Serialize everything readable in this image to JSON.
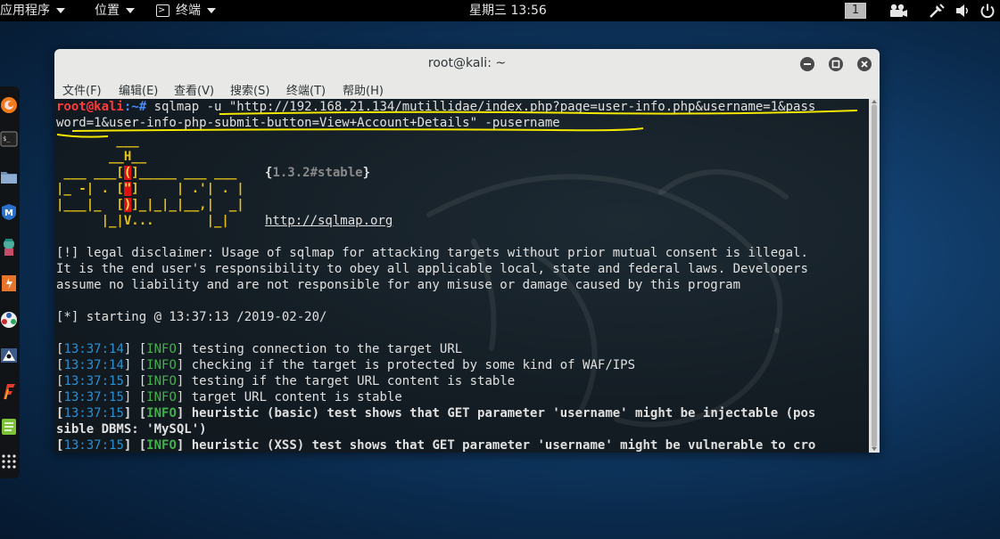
{
  "topbar": {
    "apps_label": "应用程序",
    "places_label": "位置",
    "terminal_label": "终端",
    "clock": "星期三 13:56",
    "workspace": "1"
  },
  "dock": {
    "items": [
      "firefox",
      "terminal",
      "files",
      "metasploit",
      "armitage",
      "burpsuite",
      "maltego",
      "beef",
      "faraday",
      "leafpad",
      "show-apps"
    ]
  },
  "window": {
    "title": "root@kali: ~",
    "menu": [
      "文件(F)",
      "编辑(E)",
      "查看(V)",
      "搜索(S)",
      "终端(T)",
      "帮助(H)"
    ]
  },
  "terminal": {
    "prompt_user": "root@kali",
    "prompt_rest": ":~# ",
    "command_line1": "sqlmap -u \"http://192.168.21.134/mutillidae/index.php?page=user-info.php&username=1&pass",
    "command_line2": "word=1&user-info-php-submit-button=View+Account+Details\" -pusername",
    "logo": {
      "line1": "        ___",
      "line2": "       __H__",
      "line3": " ___ ___[(]_____ ___ ___  ",
      "line4": "|_ -| . [\"]     | .'| . |",
      "line5": "|___|_  [)]_|_|_|__,|  _|",
      "line6": "      |_|V...       |_|   "
    },
    "version": "1.3.2#stable",
    "url": "http://sqlmap.org",
    "disclaimer1": "[!] legal disclaimer: Usage of sqlmap for attacking targets without prior mutual consent is illegal.",
    "disclaimer2": "It is the end user's responsibility to obey all applicable local, state and federal laws. Developers",
    "disclaimer3": "assume no liability and are not responsible for any misuse or damage caused by this program",
    "starting": "[*] starting @ 13:37:13 /2019-02-20/",
    "logs": [
      {
        "time": "13:37:14",
        "level": "INFO",
        "msg": "testing connection to the target URL",
        "bold": false
      },
      {
        "time": "13:37:14",
        "level": "INFO",
        "msg": "checking if the target is protected by some kind of WAF/IPS",
        "bold": false
      },
      {
        "time": "13:37:15",
        "level": "INFO",
        "msg": "testing if the target URL content is stable",
        "bold": false
      },
      {
        "time": "13:37:15",
        "level": "INFO",
        "msg": "target URL content is stable",
        "bold": false
      },
      {
        "time": "13:37:15",
        "level": "INFO",
        "msg": "heuristic (basic) test shows that GET parameter 'username' might be injectable (pos",
        "bold": true
      },
      {
        "time": "13:37:15",
        "level": "INFO",
        "msg": "heuristic (XSS) test shows that GET parameter 'username' might be vulnerable to cro",
        "bold": true
      }
    ],
    "wrap_line": "sible DBMS: 'MySQL')"
  }
}
